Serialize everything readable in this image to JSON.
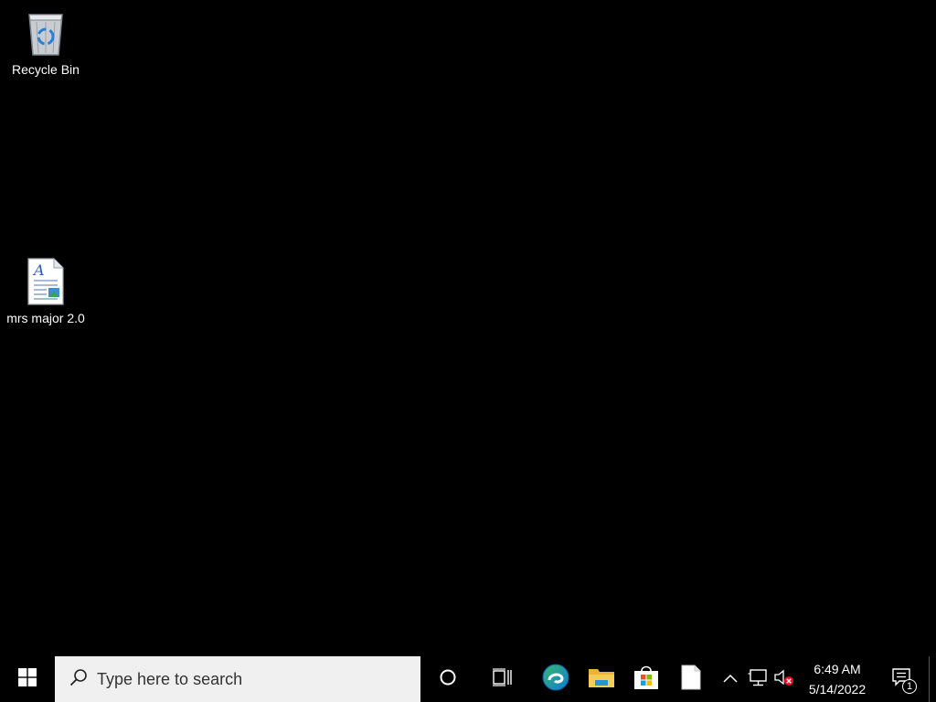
{
  "desktop": {
    "icons": [
      {
        "label": "Recycle Bin",
        "icon": "recycle-bin-icon"
      },
      {
        "label": "mrs major 2.0",
        "icon": "document-icon"
      }
    ]
  },
  "taskbar": {
    "start_icon": "windows-logo-icon",
    "search": {
      "placeholder": "Type here to search",
      "icon": "search-icon"
    },
    "pinned": [
      {
        "icon": "cortana-icon"
      },
      {
        "icon": "task-view-icon"
      },
      {
        "icon": "edge-icon"
      },
      {
        "icon": "file-explorer-icon"
      },
      {
        "icon": "store-icon"
      },
      {
        "icon": "notepad-icon"
      }
    ],
    "tray": {
      "icons": [
        "chevron-up-icon",
        "network-icon",
        "volume-muted-icon"
      ],
      "time": "6:49 AM",
      "date": "5/14/2022",
      "notification_count": "1"
    }
  },
  "colors": {
    "desktop_bg": "#000000",
    "taskbar_bg": "#000000",
    "search_bg": "#f0f0f0",
    "windows_blue": "#ffffff",
    "edge_blue": "#0f7bd6",
    "edge_green": "#36b96b",
    "folder_yellow": "#f0c24a",
    "mute_red": "#e81123"
  }
}
